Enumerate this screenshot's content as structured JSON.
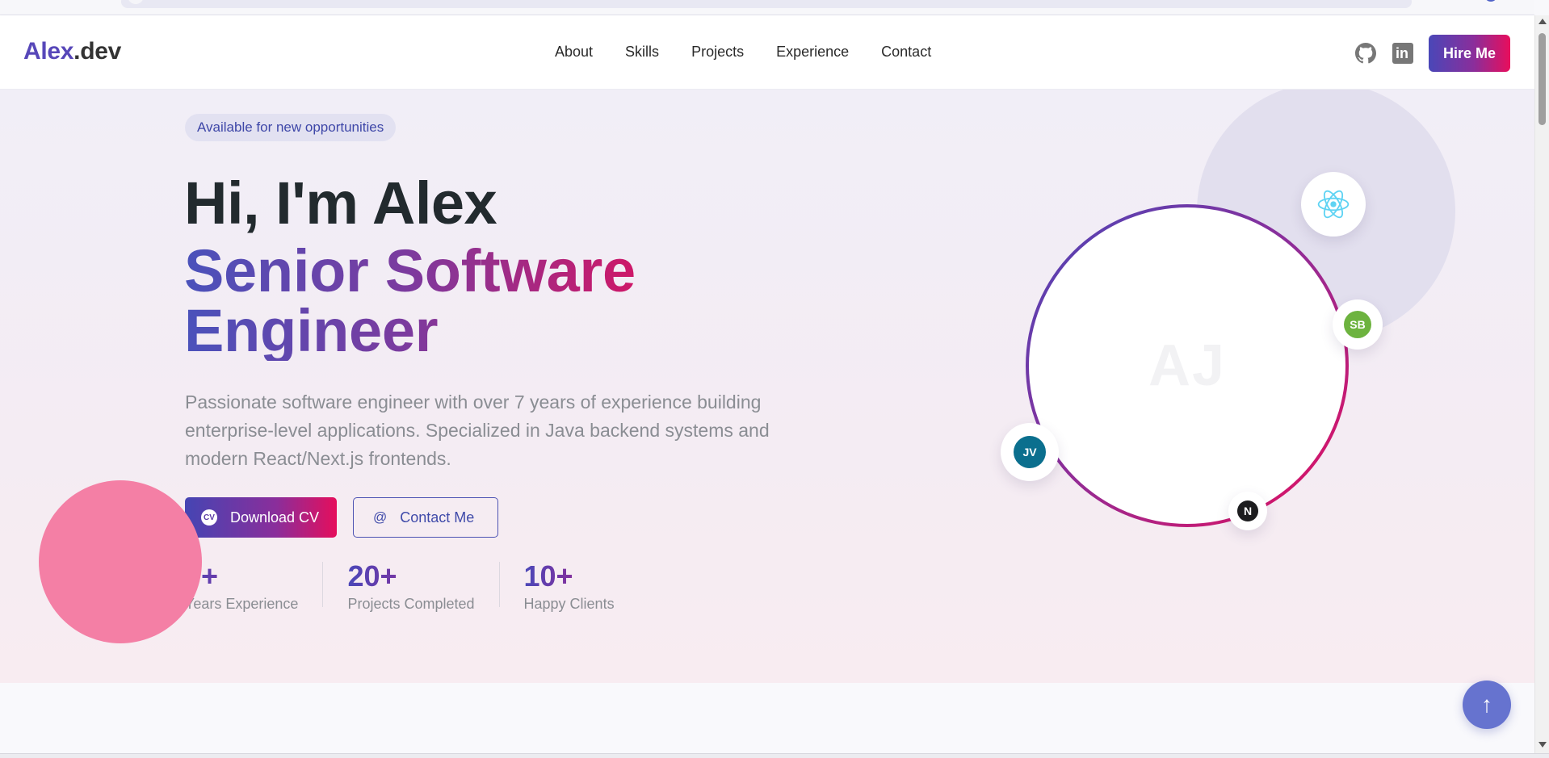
{
  "nav": {
    "logo_main": "Alex",
    "logo_suffix": ".dev",
    "links": [
      "About",
      "Skills",
      "Projects",
      "Experience",
      "Contact"
    ],
    "icons": [
      "github-icon",
      "linkedin-icon"
    ],
    "linkedin_glyph": "in",
    "hire_label": "Hire Me"
  },
  "hero": {
    "badge": "Available for new opportunities",
    "greeting": "Hi, I'm Alex",
    "role": "Senior Software Engineer",
    "description": "Passionate software engineer with over 7 years of experience building enterprise-level applications. Specialized in Java backend systems and modern React/Next.js frontends.",
    "download_label": "Download CV",
    "download_icon_text": "CV",
    "contact_label": "Contact Me",
    "contact_icon_text": "@",
    "stats": [
      {
        "value": "7+",
        "label": "Years Experience"
      },
      {
        "value": "20+",
        "label": "Projects Completed"
      },
      {
        "value": "10+",
        "label": "Happy Clients"
      }
    ]
  },
  "illustration": {
    "initials": "AJ",
    "badges": {
      "react": "react-icon",
      "spring_boot": "SB",
      "java": "JV",
      "nextjs": "N"
    }
  },
  "scroll_top_symbol": "↑",
  "colors": {
    "brand_start": "#4a47b8",
    "brand_mid": "#8a2e9b",
    "brand_end": "#e80e5c",
    "badge_bg": "#e2e1f1",
    "pink_circle": "#f47fa5",
    "spring": "#6db33f",
    "java": "#0b6f8e"
  }
}
